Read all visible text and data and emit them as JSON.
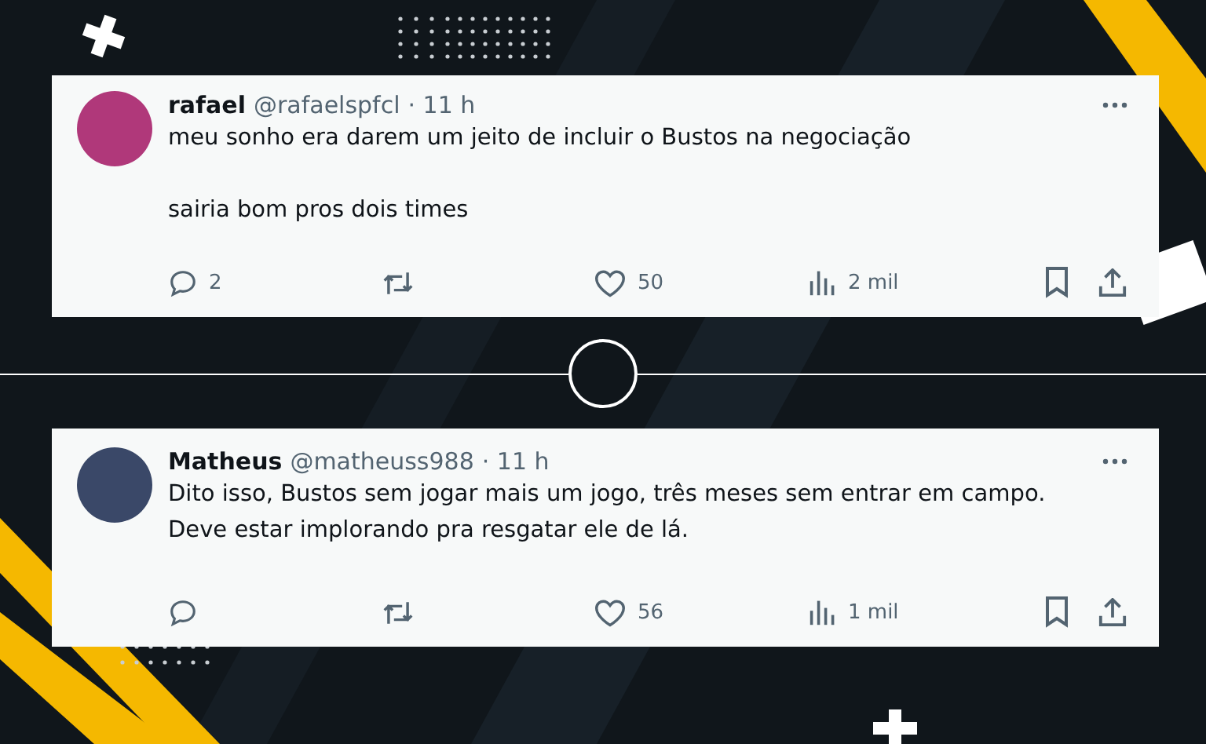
{
  "tweets": [
    {
      "name": "rafael",
      "handle": "@rafaelspfcl",
      "time": "· 11 h",
      "paragraphs": [
        "meu sonho era darem um jeito de incluir o Bustos na negociação",
        "sairia bom pros dois times"
      ],
      "replies": "2",
      "likes": "50",
      "views": "2 mil"
    },
    {
      "name": "Matheus",
      "handle": "@matheuss988",
      "time": "· 11 h",
      "lines": [
        "Dito isso, Bustos sem jogar mais um jogo, três meses sem entrar em campo.",
        "Deve estar implorando pra resgatar ele de lá."
      ],
      "likes": "56",
      "views": "1 mil"
    }
  ]
}
